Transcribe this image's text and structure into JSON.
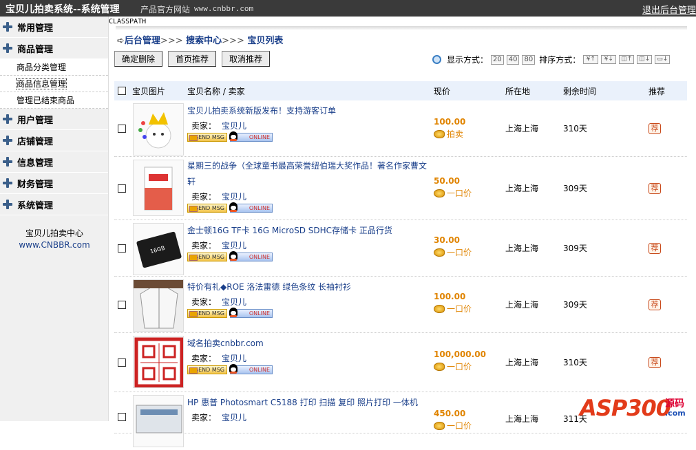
{
  "topbar": {
    "title": "宝贝儿拍卖系统--系统管理",
    "site_label": "产品官方网站",
    "site_url": "www.cnbbr.com",
    "logout": "退出后台管理"
  },
  "sidebar": {
    "groups": [
      {
        "label": "常用管理"
      },
      {
        "label": "商品管理"
      },
      {
        "label": "用户管理"
      },
      {
        "label": "店铺管理"
      },
      {
        "label": "信息管理"
      },
      {
        "label": "财务管理"
      },
      {
        "label": "系统管理"
      }
    ],
    "sub_items": [
      "商品分类管理",
      "商品信息管理",
      "管理已结束商品"
    ],
    "footer_name": "宝贝儿拍卖中心",
    "footer_url": "www.CNBBR.com"
  },
  "main": {
    "classpath": "CLASSPATH",
    "breadcrumb": [
      "后台管理",
      "搜索中心",
      "宝贝列表"
    ],
    "breadcrumb_sep": ">>>",
    "buttons": {
      "delete": "确定删除",
      "home_recommend": "首页推荐",
      "cancel_recommend": "取消推荐"
    },
    "view_label": "显示方式：",
    "view_options": [
      "20",
      "40",
      "80"
    ],
    "sort_label": "排序方式：",
    "columns": {
      "image": "宝贝图片",
      "name": "宝贝名称 / 卖家",
      "price": "现价",
      "location": "所在地",
      "time_left": "剩余时间",
      "recommend": "推荐"
    },
    "seller_label": "卖家：",
    "send_msg": "SEND MSG",
    "online": "ONLINE",
    "rec_label": "荐",
    "items": [
      {
        "name": "宝贝儿拍卖系统新版发布！支持游客订单",
        "seller": "宝贝儿",
        "price": "100.00",
        "ptype": "拍卖",
        "location": "上海上海",
        "time": "310天"
      },
      {
        "name": "星期三的战争（全球童书最高荣誉纽伯瑞大奖作品！著名作家曹文轩",
        "seller": "宝贝儿",
        "price": "50.00",
        "ptype": "一口价",
        "location": "上海上海",
        "time": "309天"
      },
      {
        "name": "金士顿16G TF卡 16G MicroSD SDHC存储卡 正品行货",
        "seller": "宝贝儿",
        "price": "30.00",
        "ptype": "一口价",
        "location": "上海上海",
        "time": "309天"
      },
      {
        "name": "特价有礼◆ROE 洛法雷德 绿色条纹 长袖衬衫",
        "seller": "宝贝儿",
        "price": "100.00",
        "ptype": "一口价",
        "location": "上海上海",
        "time": "309天"
      },
      {
        "name": "域名拍卖cnbbr.com",
        "seller": "宝贝儿",
        "price": "100,000.00",
        "ptype": "一口价",
        "location": "上海上海",
        "time": "310天"
      },
      {
        "name": "HP 惠普 Photosmart C5188 打印 扫描 复印 照片打印 一体机",
        "seller": "宝贝儿",
        "price": "450.00",
        "ptype": "一口价",
        "location": "上海上海",
        "time": "311天"
      }
    ]
  },
  "watermark": {
    "text": "ASP300",
    "zh": "源码",
    "com": ".com"
  },
  "colors": {
    "topbar": "#3a3a3a",
    "link": "#1a3f8a",
    "price": "#e08400",
    "header_bg": "#eaf1fb"
  }
}
